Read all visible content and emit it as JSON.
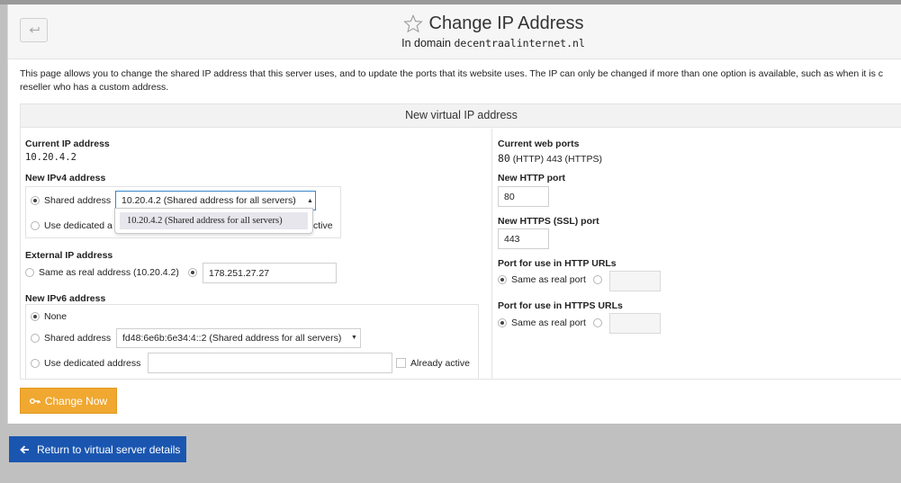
{
  "header": {
    "title": "Change IP Address",
    "subtitle_prefix": "In domain",
    "domain": "decentraalinternet.nl"
  },
  "description": {
    "line1": "This page allows you to change the shared IP address that this server uses, and to update the ports that its website uses. The IP can only be changed if more than one option is available, such as when it is c",
    "line2": "reseller who has a custom address."
  },
  "form": {
    "heading": "New virtual IP address",
    "current_ip": {
      "label": "Current IP address",
      "value": "10.20.4.2"
    },
    "new_ipv4": {
      "label": "New IPv4 address",
      "shared_label": "Shared address",
      "shared_selected": "10.20.4.2 (Shared address for all servers)",
      "dedicated_label_visible": "Use dedicated a",
      "already_active_partial": "ctive",
      "dropdown_options": [
        "10.20.4.2 (Shared address for all servers)"
      ]
    },
    "external_ip": {
      "label": "External IP address",
      "same_as_real_label": "Same as real address (10.20.4.2)",
      "value": "178.251.27.27"
    },
    "new_ipv6": {
      "label": "New IPv6 address",
      "none_label": "None",
      "shared_label": "Shared address",
      "shared_selected": "fd48:6e6b:6e34:4::2 (Shared address for all servers)",
      "dedicated_label": "Use dedicated address",
      "dedicated_value": "",
      "already_active_label": "Already active"
    },
    "current_ports": {
      "label": "Current web ports",
      "http": "80",
      "value_suffix": " (HTTP) 443 (HTTPS)"
    },
    "new_http_port": {
      "label": "New HTTP port",
      "value": "80"
    },
    "new_https_port": {
      "label": "New HTTPS (SSL) port",
      "value": "443"
    },
    "http_url_port": {
      "label": "Port for use in HTTP URLs",
      "same_label": "Same as real port"
    },
    "https_url_port": {
      "label": "Port for use in HTTPS URLs",
      "same_label": "Same as real port"
    }
  },
  "buttons": {
    "change_now": "Change Now",
    "return": "Return to virtual server details"
  },
  "colors": {
    "change_button": "#f0a830",
    "return_button": "#1a56b0",
    "background": "#c0c0c0"
  }
}
